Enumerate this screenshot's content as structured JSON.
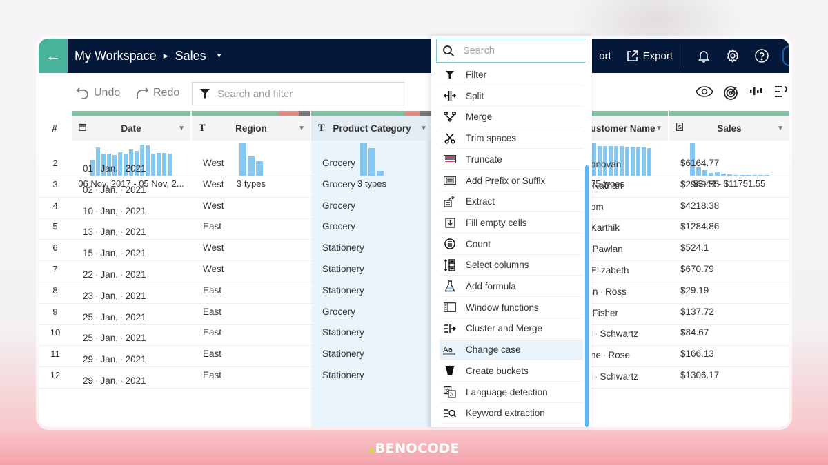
{
  "topbar": {
    "workspace": "My Workspace",
    "dataset": "Sales",
    "import_label": "ort",
    "export_label": "Export"
  },
  "toolbar": {
    "undo_label": "Undo",
    "redo_label": "Redo",
    "search_placeholder": "Search and filter"
  },
  "grid": {
    "rownum_header": "#",
    "columns": [
      {
        "name": "Date",
        "type_icon": "calendar-icon",
        "summary": "06 Nov, 2017 - 05 Nov, 2...",
        "histogram": [
          0.5,
          0.88,
          0.68,
          0.68,
          0.64,
          0.72,
          0.68,
          0.82,
          0.78,
          0.96,
          0.94,
          0.68,
          0.7,
          0.7,
          0.68
        ]
      },
      {
        "name": "Region",
        "type_icon": "text-type-icon",
        "summary": "3 types",
        "histogram": [
          1.0,
          0.6,
          0.46
        ]
      },
      {
        "name": "Product Category",
        "type_icon": "text-type-icon",
        "summary": "3 types",
        "histogram": [
          1.0,
          0.86,
          0.16
        ]
      },
      {
        "name": "Customer Name",
        "type_icon": "text-type-icon",
        "summary": "75 types",
        "histogram": [
          1.0,
          0.92,
          0.92,
          0.92,
          0.92,
          0.92,
          0.9,
          0.9,
          0.9,
          0.88,
          0.86
        ]
      },
      {
        "name": "Sales",
        "type_icon": "currency-icon",
        "summary": "$3.44 - $11751.55",
        "histogram": [
          1.0,
          0.28,
          0.18,
          0.1,
          0.12,
          0.08,
          0.06,
          0.05,
          0.03,
          0.03,
          0.03,
          0.03,
          0.03
        ]
      }
    ],
    "rows": [
      {
        "n": "2",
        "day": "01",
        "month": "Jan,",
        "year": "2021",
        "region": "West",
        "category": "Grocery",
        "customer_a": "onovan",
        "customer_b": "",
        "sales": "$6164.77"
      },
      {
        "n": "3",
        "day": "02",
        "month": "Jan,",
        "year": "2021",
        "region": "West",
        "category": "Grocery",
        "customer_a": "",
        "customer_b": "Nathan",
        "sales": "$2969.55"
      },
      {
        "n": "4",
        "day": "10",
        "month": "Jan,",
        "year": "2021",
        "region": "West",
        "category": "Grocery",
        "customer_a": "om",
        "customer_b": "",
        "sales": "$4218.38"
      },
      {
        "n": "5",
        "day": "13",
        "month": "Jan,",
        "year": "2021",
        "region": "East",
        "category": "Grocery",
        "customer_a": "Karthik",
        "customer_b": "",
        "sales": "$1284.86"
      },
      {
        "n": "6",
        "day": "15",
        "month": "Jan,",
        "year": "2021",
        "region": "West",
        "category": "Stationery",
        "customer_a": "",
        "customer_b": "Pawlan",
        "sales": "$524.1"
      },
      {
        "n": "7",
        "day": "22",
        "month": "Jan,",
        "year": "2021",
        "region": "West",
        "category": "Stationery",
        "customer_a": "Elizabeth",
        "customer_b": "",
        "sales": "$670.79"
      },
      {
        "n": "8",
        "day": "23",
        "month": "Jan,",
        "year": "2021",
        "region": "East",
        "category": "Stationery",
        "customer_a": "in",
        "customer_b": "Ross",
        "sales": "$29.19"
      },
      {
        "n": "9",
        "day": "25",
        "month": "Jan,",
        "year": "2021",
        "region": "East",
        "category": "Grocery",
        "customer_a": "",
        "customer_b": "Fisher",
        "sales": "$137.72"
      },
      {
        "n": "10",
        "day": "25",
        "month": "Jan,",
        "year": "2021",
        "region": "East",
        "category": "Stationery",
        "customer_a": "l",
        "customer_b": "Schwartz",
        "sales": "$84.67"
      },
      {
        "n": "11",
        "day": "29",
        "month": "Jan,",
        "year": "2021",
        "region": "East",
        "category": "Stationery",
        "customer_a": "ne",
        "customer_b": "Rose",
        "sales": "$166.13"
      },
      {
        "n": "12",
        "day": "29",
        "month": "Jan,",
        "year": "2021",
        "region": "East",
        "category": "Stationery",
        "customer_a": "l",
        "customer_b": "Schwartz",
        "sales": "$1306.17"
      }
    ]
  },
  "menu": {
    "search_placeholder": "Search",
    "highlighted_index": 13,
    "items": [
      {
        "label": "Filter",
        "icon": "filter-icon"
      },
      {
        "label": "Split",
        "icon": "split-icon"
      },
      {
        "label": "Merge",
        "icon": "merge-icon"
      },
      {
        "label": "Trim spaces",
        "icon": "scissors-icon"
      },
      {
        "label": "Truncate",
        "icon": "truncate-icon"
      },
      {
        "label": "Add Prefix or Suffix",
        "icon": "prefix-suffix-icon"
      },
      {
        "label": "Extract",
        "icon": "extract-icon"
      },
      {
        "label": "Fill empty cells",
        "icon": "fill-cells-icon"
      },
      {
        "label": "Count",
        "icon": "count-icon"
      },
      {
        "label": "Select columns",
        "icon": "select-columns-icon"
      },
      {
        "label": "Add formula",
        "icon": "flask-icon"
      },
      {
        "label": "Window functions",
        "icon": "window-functions-icon"
      },
      {
        "label": "Cluster and Merge",
        "icon": "cluster-merge-icon"
      },
      {
        "label": "Change case",
        "icon": "change-case-icon"
      },
      {
        "label": "Create buckets",
        "icon": "bucket-icon"
      },
      {
        "label": "Language detection",
        "icon": "language-icon"
      },
      {
        "label": "Keyword extraction",
        "icon": "keyword-search-icon"
      }
    ]
  },
  "colors": {
    "nav_bg": "#04193a",
    "accent_teal": "#47b39b",
    "quality_good": "#7fc4a0",
    "quality_bad": "#e88a80",
    "quality_missing": "#777777",
    "histogram_bar": "#86c6ef",
    "selected_column_bg": "#eaf4fc"
  },
  "watermark": {
    "text": "BENOCODE"
  }
}
